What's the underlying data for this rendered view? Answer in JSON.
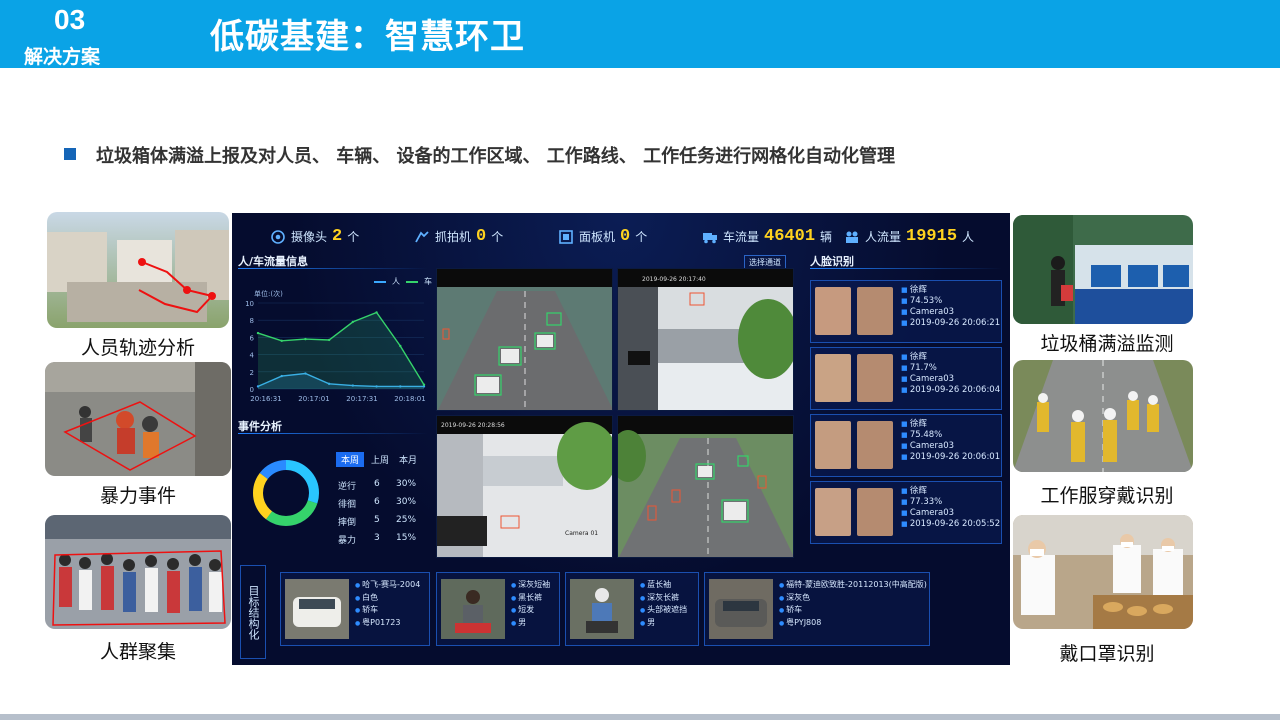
{
  "header": {
    "section_number": "03",
    "section_label": "解决方案",
    "title": "低碳基建：智慧环卫"
  },
  "bullet_text": "垃圾箱体满溢上报及对人员、 车辆、 设备的工作区域、 工作路线、 工作任务进行网格化自动化管理",
  "left_thumbnails": [
    {
      "label": "人员轨迹分析"
    },
    {
      "label": "暴力事件"
    },
    {
      "label": "人群聚集"
    }
  ],
  "right_thumbnails": [
    {
      "label": "垃圾桶满溢监测"
    },
    {
      "label": "工作服穿戴识别"
    },
    {
      "label": "戴口罩识别"
    }
  ],
  "dashboard": {
    "stats": [
      {
        "label": "摄像头",
        "value": "2",
        "unit": "个",
        "icon": "camera-icon"
      },
      {
        "label": "抓拍机",
        "value": "0",
        "unit": "个",
        "icon": "snapshot-icon"
      },
      {
        "label": "面板机",
        "value": "0",
        "unit": "个",
        "icon": "panel-icon"
      },
      {
        "label": "车流量",
        "value": "46401",
        "unit": "辆",
        "icon": "truck-icon"
      },
      {
        "label": "人流量",
        "value": "19915",
        "unit": "人",
        "icon": "people-icon"
      }
    ],
    "flow_panel": {
      "title": "人/车流量信息",
      "unit_label": "单位:(次)",
      "legend_person": "人",
      "legend_car": "车",
      "y_ticks": [
        "10",
        "8",
        "6",
        "4",
        "2",
        "0"
      ],
      "x_ticks": [
        "20:16:31",
        "20:17:01",
        "20:17:31",
        "20:18:01"
      ]
    },
    "select_channel": "选择通道",
    "camera_labels": [
      "2019-09-26  20:17:40",
      "2019-09-26  20:28:56",
      "Camera 01"
    ],
    "face_panel_title": "人脸识别",
    "faces": [
      {
        "name": "徐辉",
        "score": "74.53%",
        "camera": "Camera03",
        "time": "2019-09-26 20:06:21"
      },
      {
        "name": "徐辉",
        "score": "71.7%",
        "camera": "Camera03",
        "time": "2019-09-26 20:06:04"
      },
      {
        "name": "徐辉",
        "score": "75.48%",
        "camera": "Camera03",
        "time": "2019-09-26 20:06:01"
      },
      {
        "name": "徐辉",
        "score": "77.33%",
        "camera": "Camera03",
        "time": "2019-09-26 20:05:52"
      }
    ],
    "event_panel": {
      "title": "事件分析",
      "tabs": [
        "本周",
        "上周",
        "本月"
      ],
      "rows": [
        {
          "name": "逆行",
          "count": "6",
          "pct": "30%"
        },
        {
          "name": "徘徊",
          "count": "6",
          "pct": "30%"
        },
        {
          "name": "摔倒",
          "count": "5",
          "pct": "25%"
        },
        {
          "name": "暴力",
          "count": "3",
          "pct": "15%"
        }
      ]
    },
    "structure_title": "目标结构化",
    "vehicles": [
      {
        "lines": [
          "哈飞-赛马-2004",
          "白色",
          "轿车",
          "粤P01723"
        ]
      },
      {
        "lines": [
          "深灰短袖",
          "黑长裤",
          "短发",
          "男"
        ]
      },
      {
        "lines": [
          "蓝长袖",
          "深灰长裤",
          "头部被遮挡",
          "男"
        ]
      },
      {
        "lines": [
          "福特-蒙迪欧致胜-20112013(中高配版)",
          "深灰色",
          "轿车",
          "粤PYJ808"
        ]
      }
    ],
    "colors": {
      "bg": "#050c2e",
      "accent": "#1b6cf0",
      "highlight": "#ffd21f",
      "line_person": "#3aa8ff",
      "line_car": "#35d36b"
    }
  },
  "chart_data": {
    "type": "line",
    "title": "人/车流量信息",
    "ylabel": "单位:(次)",
    "x": [
      "20:16:31",
      "20:17:01",
      "20:17:31",
      "20:18:01"
    ],
    "ylim": [
      0,
      10
    ],
    "series": [
      {
        "name": "人",
        "values": [
          0.3,
          1.5,
          1.8,
          0.6,
          0.4,
          0.3,
          0.3,
          0.3
        ]
      },
      {
        "name": "车",
        "values": [
          6.5,
          5.6,
          5.8,
          5.7,
          7.8,
          8.9,
          5.0,
          0.5
        ]
      }
    ]
  }
}
